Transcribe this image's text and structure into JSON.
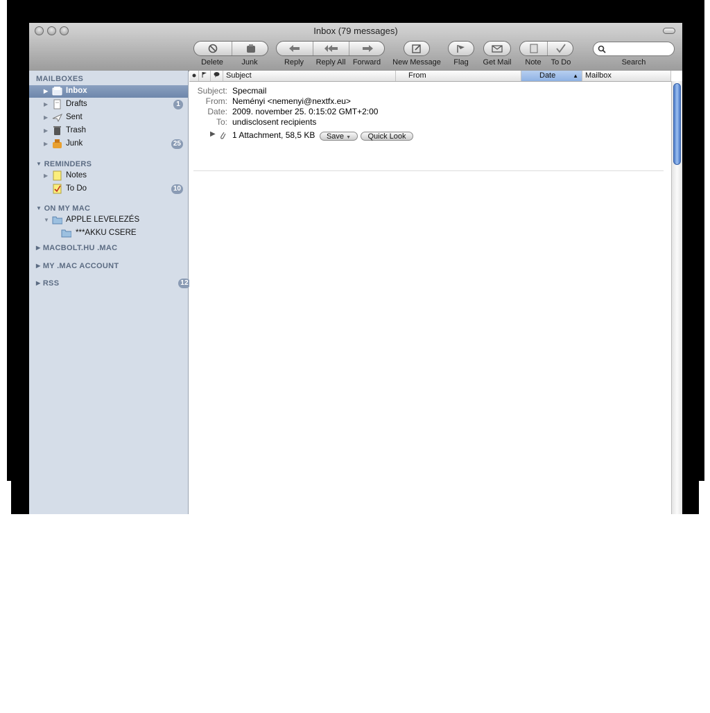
{
  "window": {
    "title": "Inbox (79 messages)"
  },
  "toolbar": {
    "delete_label": "Delete",
    "junk_label": "Junk",
    "reply_label": "Reply",
    "reply_all_label": "Reply All",
    "forward_label": "Forward",
    "new_message_label": "New Message",
    "flag_label": "Flag",
    "get_mail_label": "Get Mail",
    "note_label": "Note",
    "todo_label": "To Do",
    "search_label": "Search",
    "search_value": ""
  },
  "sidebar": {
    "mailboxes_header": "MAILBOXES",
    "mailboxes": [
      {
        "label": "Inbox",
        "icon": "inbox-icon",
        "badge": ""
      },
      {
        "label": "Drafts",
        "icon": "drafts-icon",
        "badge": "1"
      },
      {
        "label": "Sent",
        "icon": "sent-icon",
        "badge": ""
      },
      {
        "label": "Trash",
        "icon": "trash-icon",
        "badge": ""
      },
      {
        "label": "Junk",
        "icon": "junk-icon",
        "badge": "25"
      }
    ],
    "reminders_header": "REMINDERS",
    "reminders": [
      {
        "label": "Notes",
        "icon": "notes-icon",
        "badge": ""
      },
      {
        "label": "To Do",
        "icon": "todo-icon",
        "badge": "10"
      }
    ],
    "on_my_mac_header": "ON MY MAC",
    "on_my_mac": [
      {
        "label": "APPLE LEVELEZÉS",
        "icon": "folder-icon"
      },
      {
        "label": "***AKKU CSERE",
        "icon": "folder-icon"
      }
    ],
    "macbolt_header": "MACBOLT.HU .MAC",
    "mac_account_header": "MY .MAC ACCOUNT",
    "rss_header": "RSS",
    "rss_badge": "12"
  },
  "columns": {
    "subject": "Subject",
    "from": "From",
    "date": "Date",
    "mailbox": "Mailbox"
  },
  "message": {
    "subject_label": "Subject:",
    "subject": "Specmail",
    "from_label": "From:",
    "from": "Neményi <nemenyi@nextfx.eu>",
    "date_label": "Date:",
    "date": "2009. november 25.  0:15:02 GMT+2:00",
    "to_label": "To:",
    "to": "undisclosent recipients",
    "attachment_text": "1 Attachment, 58,5 KB",
    "save_label": "Save",
    "quicklook_label": "Quick Look"
  },
  "colors": {
    "sidebar_bg": "#d5dde8",
    "selection": "#7a91b3",
    "scroll_thumb": "#6e9ae0"
  }
}
